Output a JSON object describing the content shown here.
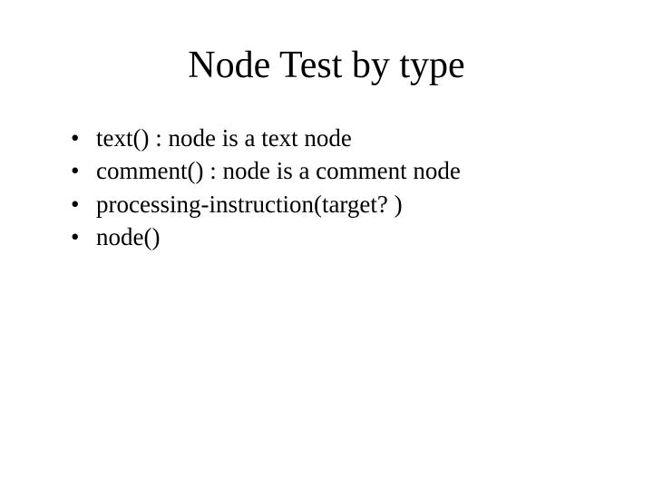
{
  "slide": {
    "title": "Node Test by type",
    "bullets": [
      "text() : node is a text node",
      "comment() : node is a comment node",
      "processing-instruction(target? )",
      "node()"
    ],
    "bullet_marker": "•"
  }
}
